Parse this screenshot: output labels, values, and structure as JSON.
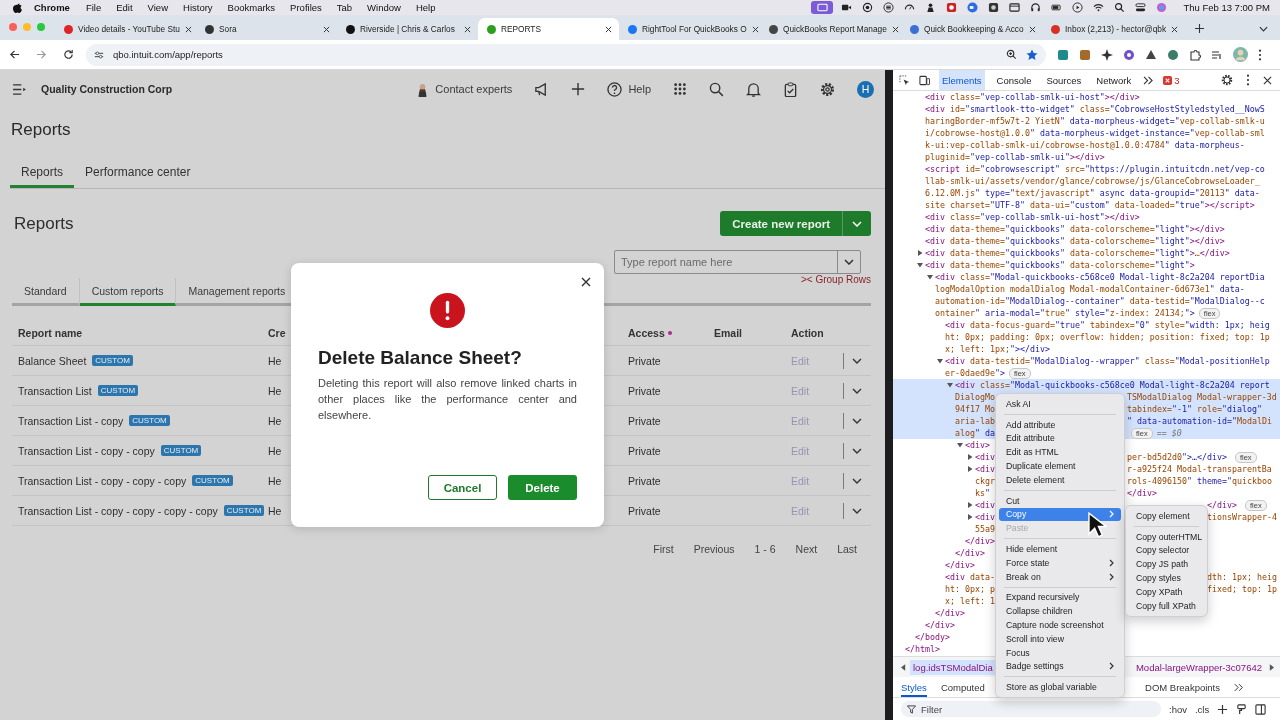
{
  "menubar": {
    "app": "Chrome",
    "menus": [
      "File",
      "Edit",
      "View",
      "History",
      "Bookmarks",
      "Profiles",
      "Tab",
      "Window",
      "Help"
    ],
    "clock": "Thu Feb 13  7:00 PM"
  },
  "browser": {
    "tabs": [
      {
        "title": "Video details - YouTube Stu",
        "color": "#e02424",
        "selected": false
      },
      {
        "title": "Sora",
        "color": "#333333",
        "selected": false
      },
      {
        "title": "Riverside | Chris & Carlos",
        "color": "#111111",
        "selected": false
      },
      {
        "title": "REPORTS",
        "color": "#2ca01c",
        "selected": true
      },
      {
        "title": "RightTool For QuickBooks O",
        "color": "#1877f2",
        "selected": false
      },
      {
        "title": "QuickBooks Report Manage",
        "color": "#444444",
        "selected": false
      },
      {
        "title": "Quick Bookkeeping & Acco",
        "color": "#3b6fd8",
        "selected": false
      },
      {
        "title": "Inbox (2,213) - hector@qbk",
        "color": "#d93025",
        "selected": false
      }
    ],
    "url": "qbo.intuit.com/app/reports"
  },
  "app": {
    "company": "Quality Construction Corp",
    "contact": "Contact experts",
    "help": "Help",
    "avatar": "H",
    "title": "Reports",
    "tabs": [
      {
        "label": "Reports",
        "selected": true
      },
      {
        "label": "Performance center",
        "selected": false
      }
    ],
    "section_title": "Reports",
    "create_button": "Create new report",
    "search": {
      "placeholder": "Type report name here"
    },
    "group_rows": ">< Group Rows",
    "report_tabs": [
      {
        "label": "Standard",
        "selected": false
      },
      {
        "label": "Custom reports",
        "selected": true
      },
      {
        "label": "Management reports",
        "selected": false
      }
    ],
    "table": {
      "columns": [
        "Report name",
        "Cre",
        "Access",
        "Email",
        "Action"
      ],
      "rows": [
        {
          "name": "Balance Sheet",
          "badge": "CUSTOM",
          "column_2": "He",
          "access": "Private",
          "action": "Edit"
        },
        {
          "name": "Transaction List",
          "badge": "CUSTOM",
          "column_2": "He",
          "access": "Private",
          "action": "Edit"
        },
        {
          "name": "Transaction List - copy",
          "badge": "CUSTOM",
          "column_2": "He",
          "access": "Private",
          "action": "Edit"
        },
        {
          "name": "Transaction List - copy - copy",
          "badge": "CUSTOM",
          "column_2": "He",
          "access": "Private",
          "action": "Edit"
        },
        {
          "name": "Transaction List - copy - copy - copy",
          "badge": "CUSTOM",
          "column_2": "He",
          "access": "Private",
          "action": "Edit"
        },
        {
          "name": "Transaction List - copy - copy - copy - copy",
          "badge": "CUSTOM",
          "column_2": "He",
          "access": "Private",
          "action": "Edit"
        }
      ]
    },
    "pagination": [
      "First",
      "Previous",
      "1 - 6",
      "Next",
      "Last"
    ],
    "modal": {
      "title": "Delete Balance Sheet?",
      "message": "Deleting this report will also remove linked charts in other places like the performance center and elsewhere.",
      "buttons": [
        {
          "label": "Cancel",
          "kind": "secondary"
        },
        {
          "label": "Delete",
          "kind": "primary"
        }
      ]
    }
  },
  "devtools": {
    "tabs": [
      {
        "label": "Elements",
        "selected": true
      },
      {
        "label": "Console",
        "selected": false
      },
      {
        "label": "Sources",
        "selected": false
      },
      {
        "label": "Network",
        "selected": false
      }
    ],
    "error_count": "3",
    "tree": {
      "closing": "</html>",
      "children": [
        {
          "closing": "</body>",
          "children": [
            {
              "selected": false,
              "lines": [
                {
                  "text": "<div class=\"vep-collab-smlk-ui-host\"></div>"
                }
              ]
            },
            {
              "selected": false,
              "lines": [
                {
                  "text": "<div id=\"smartlook-tto-widget\" class=\"CobrowseHostStyledstyled__NowS"
                },
                {
                  "text": "haringBorder-mf5w7t-2 YietN\" data-morpheus-widget=\"vep-collab-smlk-u"
                },
                {
                  "text": "i/cobrowse-host@1.0.0\" data-morpheus-widget-instance=\"vep-collab-sml"
                },
                {
                  "text": "k-ui:vep-collab-smlk-ui/cobrowse-host@1.0.0:4784\" data-morpheus-"
                },
                {
                  "text": "pluginid=\"vep-collab-smlk-ui\"></div>"
                }
              ]
            },
            {
              "selected": false,
              "lines": [
                {
                  "text": "<script id=\"cobrowsescript\" src=\"https://plugin.intuitcdn.net/vep-co"
                },
                {
                  "text": "llab-smlk-ui/assets/vendor/glance/cobrowse/js/GlanceCobrowseLoader_"
                },
                {
                  "text": "6.12.0M.js\" type=\"text/javascript\" async data-groupid=\"20113\" data-"
                },
                {
                  "text": "site charset=\"UTF-8\" data-ui=\"custom\" data-loaded=\"true\"></script>"
                }
              ]
            },
            {
              "selected": false,
              "lines": [
                {
                  "text": "<div class=\"vep-collab-smlk-ui-host\"></div>"
                }
              ]
            },
            {
              "selected": false,
              "lines": [
                {
                  "text": "<div data-theme=\"quickbooks\" data-colorscheme=\"light\"></div>"
                }
              ]
            },
            {
              "selected": false,
              "lines": [
                {
                  "text": "<div data-theme=\"quickbooks\" data-colorscheme=\"light\"></div>"
                }
              ]
            },
            {
              "selected": false,
              "expanded": false,
              "lines": [
                {
                  "text": "<div data-theme=\"quickbooks\" data-colorscheme=\"light\">…</div>"
                }
              ]
            },
            {
              "selected": false,
              "expanded": true,
              "closing": "</div>",
              "lines": [
                {
                  "text": "<div data-theme=\"quickbooks\" data-colorscheme=\"light\">"
                }
              ],
              "children": [
                {
                  "selected": false,
                  "expanded": true,
                  "closing": "</div>",
                  "lines": [
                    {
                      "text": "<div class=\"Modal-quickbooks-c568ce0 Modal-light-8c2a204 reportDia"
                    },
                    {
                      "text": "logModalOption modalDialog Modal-modalContainer-6d673e1\" data-"
                    },
                    {
                      "text": "automation-id=\"ModalDialog--container\" data-testid=\"ModalDialog--c"
                    },
                    {
                      "text": "ontainer\" aria-modal=\"true\" style=\"z-index: 24134;\">",
                      "badge": "flex"
                    }
                  ],
                  "children": [
                    {
                      "selected": false,
                      "lines": [
                        {
                          "text": "<div data-focus-guard=\"true\" tabindex=\"0\" style=\"width: 1px; heig"
                        },
                        {
                          "text": "ht: 0px; padding: 0px; overflow: hidden; position: fixed; top: 1p"
                        },
                        {
                          "text": "x; left: 1px;\"></div>"
                        }
                      ]
                    },
                    {
                      "selected": false,
                      "expanded": true,
                      "closing": "</div>",
                      "lines": [
                        {
                          "text": "<div data-testid=\"ModalDialog--wrapper\" class=\"Modal-positionHelp"
                        },
                        {
                          "text": "er-0daed9e\">",
                          "badge": "flex"
                        }
                      ],
                      "children": [
                        {
                          "selected": true,
                          "expanded": true,
                          "closing": "</div>",
                          "lines": [
                            {
                              "text": "<div class=\"Modal-quickbooks-c568ce0 Modal-light-8c2a204 report"
                            },
                            {
                              "text": "DialogMo",
                              "kind": "menu",
                              "after": "TSModalDialog Modal-wrapper-3d"
                            },
                            {
                              "text": "94f17 Mo",
                              "kind": "menu",
                              "after": "tabindex=\"-1\" role=\"dialog\""
                            },
                            {
                              "text": "aria-lab",
                              "kind": "menu",
                              "after": "\" data-automation-id=\"ModalDi"
                            },
                            {
                              "text": "alog\" da",
                              "kind": "menu",
                              "badge": "flex",
                              "note": "== $0"
                            }
                          ],
                          "children": [
                            {
                              "selected": false,
                              "expanded": true,
                              "closing": "</div>",
                              "lines": [
                                {
                                  "text": "<div>"
                                }
                              ],
                              "children": [
                                {
                                  "selected": false,
                                  "expanded": false,
                                  "lines": [
                                    {
                                      "text": "<div",
                                      "kind": "menu",
                                      "after": "per-bd5d2d0\">…</div>",
                                      "badge": "flex"
                                    }
                                  ]
                                },
                                {
                                  "selected": false,
                                  "expanded": false,
                                  "lines": [
                                    {
                                      "text": "<div",
                                      "kind": "menu",
                                      "after": "r-a925f24 Modal-transparentBa"
                                    },
                                    {
                                      "text": "ckgr",
                                      "kind": "menu",
                                      "after": "rols-4096150\" theme=\"quickboo"
                                    },
                                    {
                                      "text": "ks\"",
                                      "kind": "menu",
                                      "after": "</div>"
                                    }
                                  ]
                                },
                                {
                                  "selected": false,
                                  "expanded": false,
                                  "lines": [
                                    {
                                      "text": "<div",
                                      "kind": "submenu",
                                      "after": "</div>",
                                      "badge": "flex"
                                    }
                                  ]
                                },
                                {
                                  "selected": false,
                                  "expanded": false,
                                  "lines": [
                                    {
                                      "text": "<div",
                                      "kind": "submenu",
                                      "after": "tionsWrapper-4"
                                    },
                                    {
                                      "text": "55a9"
                                    }
                                  ]
                                }
                              ]
                            }
                          ]
                        }
                      ]
                    },
                    {
                      "selected": false,
                      "lines": [
                        {
                          "text": "<div data-",
                          "kind": "submenu",
                          "after": "dth: 1px; heig"
                        },
                        {
                          "text": "ht: 0px; p",
                          "kind": "submenu",
                          "after": "fixed; top: 1p"
                        },
                        {
                          "text": "x; left: 1"
                        }
                      ]
                    }
                  ]
                }
              ]
            }
          ]
        }
      ]
    },
    "breadcrumb": {
      "left": "log.idsTSModalDia",
      "right": "Modal-largeWrapper-3c07642"
    },
    "panel_tabs": [
      {
        "label": "Styles",
        "selected": true
      },
      {
        "label": "Computed",
        "selected": false
      },
      {
        "label": "DOM Breakpoints",
        "selected": false
      }
    ],
    "filter": {
      "placeholder": "Filter"
    },
    "hov": ":hov",
    "cls": ".cls",
    "context_menu": {
      "groups": [
        [
          {
            "label": "Ask AI",
            "selected": false,
            "disabled": false,
            "submenu": false
          }
        ],
        [
          {
            "label": "Add attribute",
            "selected": false,
            "disabled": false,
            "submenu": false
          },
          {
            "label": "Edit attribute",
            "selected": false,
            "disabled": false,
            "submenu": false
          },
          {
            "label": "Edit as HTML",
            "selected": false,
            "disabled": false,
            "submenu": false
          },
          {
            "label": "Duplicate element",
            "selected": false,
            "disabled": false,
            "submenu": false
          },
          {
            "label": "Delete element",
            "selected": false,
            "disabled": false,
            "submenu": false
          }
        ],
        [
          {
            "label": "Cut",
            "selected": false,
            "disabled": false,
            "submenu": false
          },
          {
            "label": "Copy",
            "selected": true,
            "disabled": false,
            "submenu": true
          },
          {
            "label": "Paste",
            "selected": false,
            "disabled": true,
            "submenu": false
          }
        ],
        [
          {
            "label": "Hide element",
            "selected": false,
            "disabled": false,
            "submenu": false
          },
          {
            "label": "Force state",
            "selected": false,
            "disabled": false,
            "submenu": true
          },
          {
            "label": "Break on",
            "selected": false,
            "disabled": false,
            "submenu": true
          }
        ],
        [
          {
            "label": "Expand recursively",
            "selected": false,
            "disabled": false,
            "submenu": false
          },
          {
            "label": "Collapse children",
            "selected": false,
            "disabled": false,
            "submenu": false
          },
          {
            "label": "Capture node screenshot",
            "selected": false,
            "disabled": false,
            "submenu": false
          },
          {
            "label": "Scroll into view",
            "selected": false,
            "disabled": false,
            "submenu": false
          },
          {
            "label": "Focus",
            "selected": false,
            "disabled": false,
            "submenu": false
          },
          {
            "label": "Badge settings",
            "selected": false,
            "disabled": false,
            "submenu": true
          }
        ],
        [
          {
            "label": "Store as global variable",
            "selected": false,
            "disabled": false,
            "submenu": false
          }
        ]
      ]
    },
    "submenu": {
      "groups": [
        [
          {
            "label": "Copy element",
            "selected": false,
            "disabled": false,
            "submenu": false
          }
        ],
        [
          {
            "label": "Copy outerHTML",
            "selected": false,
            "disabled": false,
            "submenu": false
          },
          {
            "label": "Copy selector",
            "selected": false,
            "disabled": false,
            "submenu": false
          },
          {
            "label": "Copy JS path",
            "selected": false,
            "disabled": false,
            "submenu": false
          },
          {
            "label": "Copy styles",
            "selected": false,
            "disabled": false,
            "submenu": false
          },
          {
            "label": "Copy XPath",
            "selected": false,
            "disabled": false,
            "submenu": false
          },
          {
            "label": "Copy full XPath",
            "selected": false,
            "disabled": false,
            "submenu": false
          }
        ]
      ]
    }
  }
}
